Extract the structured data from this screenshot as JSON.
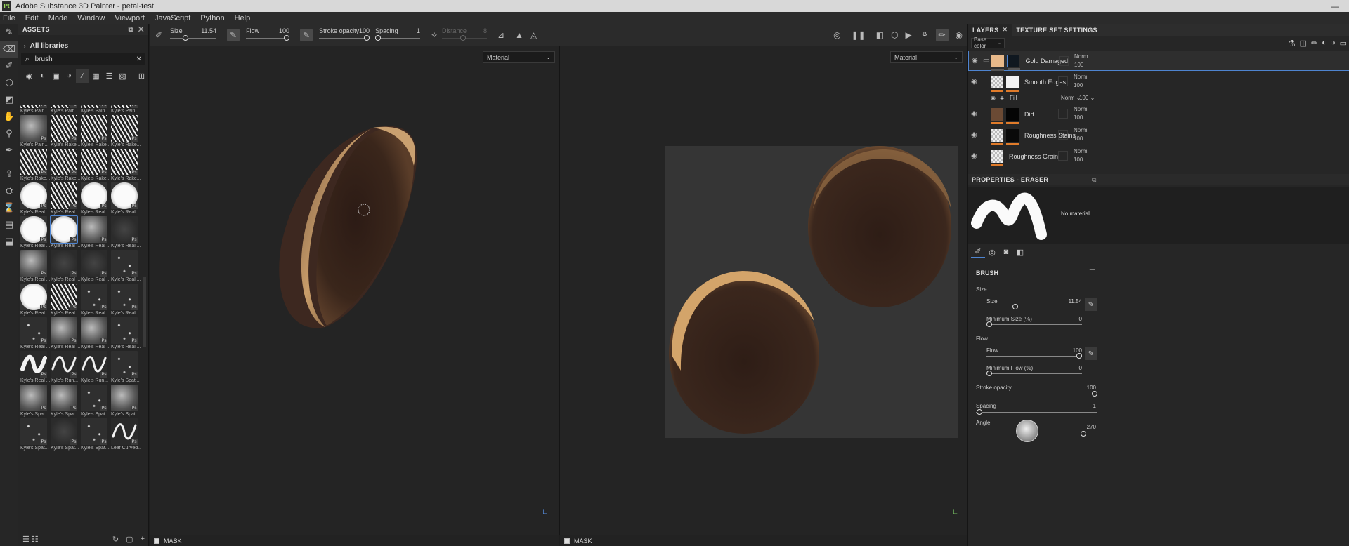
{
  "window": {
    "title": "Adobe Substance 3D Painter - petal-test",
    "logo": "Pt",
    "minimize": "—"
  },
  "menu": [
    "File",
    "Edit",
    "Mode",
    "Window",
    "Viewport",
    "JavaScript",
    "Python",
    "Help"
  ],
  "tools": [
    "paint-brush-icon",
    "eraser-icon",
    "projection-icon",
    "geometry-mask-icon",
    "polygon-fill-icon",
    "smudge-icon",
    "clone-icon",
    "color-picker-icon",
    "export-icon",
    "bake-icon",
    "history-icon",
    "document-icon",
    "package-icon"
  ],
  "assets": {
    "header": "ASSETS",
    "library": "All libraries",
    "search_value": "brush",
    "filter_icons": [
      "material-filter-icon",
      "smart-material-filter-icon",
      "texture-filter-icon",
      "mask-filter-icon",
      "brush-filter-icon",
      "pattern-filter-icon",
      "list-filter-icon",
      "environment-filter-icon",
      "grid-view-icon"
    ],
    "items": [
      {
        "label": "Kyle's Pain...",
        "style": "rake"
      },
      {
        "label": "Kyle's Pain...",
        "style": "rake"
      },
      {
        "label": "Kyle's Pain...",
        "style": "rake"
      },
      {
        "label": "Kyle's Pain...",
        "style": "rake"
      },
      {
        "label": "Kyle's Pain...",
        "style": "noise"
      },
      {
        "label": "Kyle's Rake...",
        "style": "rake"
      },
      {
        "label": "Kyle's Rake...",
        "style": "rake"
      },
      {
        "label": "Kyle's Rake...",
        "style": "rake"
      },
      {
        "label": "Kyle's Rake...",
        "style": "rake"
      },
      {
        "label": "Kyle's Rake...",
        "style": "rake"
      },
      {
        "label": "Kyle's Rake...",
        "style": "rake"
      },
      {
        "label": "Kyle's Rake...",
        "style": "rake"
      },
      {
        "label": "Kyle's Real ...",
        "style": "solid"
      },
      {
        "label": "Kyle's Real ...",
        "style": "rake"
      },
      {
        "label": "Kyle's Real ...",
        "style": "solid"
      },
      {
        "label": "Kyle's Real ...",
        "style": "solid"
      },
      {
        "label": "Kyle's Real ...",
        "style": "solid"
      },
      {
        "label": "Kyle's Real ...",
        "style": "solid"
      },
      {
        "label": "Kyle's Real ...",
        "style": "noise"
      },
      {
        "label": "Kyle's Real ...",
        "style": "dark"
      },
      {
        "label": "Kyle's Real ...",
        "style": "noise"
      },
      {
        "label": "Kyle's Real ...",
        "style": "dark"
      },
      {
        "label": "Kyle's Real ...",
        "style": "dark"
      },
      {
        "label": "Kyle's Real ...",
        "style": "speck"
      },
      {
        "label": "Kyle's Real ...",
        "style": "solid"
      },
      {
        "label": "Kyle's Real ...",
        "style": "rake"
      },
      {
        "label": "Kyle's Real ...",
        "style": "speck"
      },
      {
        "label": "Kyle's Real ...",
        "style": "speck"
      },
      {
        "label": "Kyle's Real ...",
        "style": "speck"
      },
      {
        "label": "Kyle's Real ...",
        "style": "noise"
      },
      {
        "label": "Kyle's Real ...",
        "style": "noise"
      },
      {
        "label": "Kyle's Real ...",
        "style": "speck"
      },
      {
        "label": "Kyle's Real ...",
        "style": "wave"
      },
      {
        "label": "Kyle's Run...",
        "style": "wave"
      },
      {
        "label": "Kyle's Run...",
        "style": "wave"
      },
      {
        "label": "Kyle's Spat...",
        "style": "speck"
      },
      {
        "label": "Kyle's Spat...",
        "style": "noise"
      },
      {
        "label": "Kyle's Spat...",
        "style": "noise"
      },
      {
        "label": "Kyle's Spat...",
        "style": "speck"
      },
      {
        "label": "Kyle's Spat...",
        "style": "noise"
      },
      {
        "label": "Kyle's Spat...",
        "style": "speck"
      },
      {
        "label": "Kyle's Spat...",
        "style": "dark"
      },
      {
        "label": "Kyle's Spat...",
        "style": "speck"
      },
      {
        "label": "Leaf Curved...",
        "style": "leaf"
      }
    ],
    "ps_badge": "Ps"
  },
  "toolbar": {
    "size_label": "Size",
    "size_value": "11.54",
    "flow_label": "Flow",
    "flow_value": "100",
    "opacity_label": "Stroke opacity",
    "opacity_value": "100",
    "spacing_label": "Spacing",
    "spacing_value": "1",
    "distance_label": "Distance",
    "distance_value": "8"
  },
  "viewports": {
    "left_mode": "Material",
    "right_mode": "Material",
    "mask_label": "MASK"
  },
  "layers_panel": {
    "tab_layers": "LAYERS",
    "tab_texture": "TEXTURE SET SETTINGS",
    "channel": "Base color",
    "layers": [
      {
        "name": "Gold Damaged",
        "blend": "Norm",
        "opacity": "100",
        "thumb": "#e8b98a",
        "mask": "#101820",
        "bar": "#555",
        "selected": true,
        "folder": true
      },
      {
        "name": "Smooth Edges",
        "blend": "Norm",
        "opacity": "100",
        "thumb": "checker",
        "mask": "#f2f2f2",
        "bar": "#e07b2a",
        "selected": false
      },
      {
        "name": "Dirt",
        "blend": "Norm",
        "opacity": "100",
        "thumb": "#6b4a34",
        "mask": "#050505",
        "bar": "#e07b2a",
        "selected": false
      },
      {
        "name": "Roughness Stains",
        "blend": "Norm",
        "opacity": "100",
        "thumb": "checker",
        "mask": "#0a0a0a",
        "bar": "#e07b2a",
        "selected": false
      },
      {
        "name": "Roughness Grain",
        "blend": "Norm",
        "opacity": "100",
        "thumb": "checker",
        "mask": "",
        "bar": "#e07b2a",
        "selected": false
      }
    ],
    "fill": {
      "name": "Fill",
      "blend": "Norm",
      "opacity": "100"
    }
  },
  "properties": {
    "header": "PROPERTIES - ERASER",
    "no_material": "No material",
    "section": "BRUSH",
    "size_group": "Size",
    "size_label": "Size",
    "size_value": "11.54",
    "size_frac": 0.3,
    "min_size_label": "Minimum Size (%)",
    "min_size_value": "0",
    "flow_group": "Flow",
    "flow_label": "Flow",
    "flow_value": "100",
    "min_flow_label": "Minimum Flow (%)",
    "min_flow_value": "0",
    "opacity_label": "Stroke opacity",
    "opacity_value": "100",
    "spacing_label": "Spacing",
    "spacing_value": "1",
    "angle_label": "Angle",
    "angle_value": "270"
  }
}
